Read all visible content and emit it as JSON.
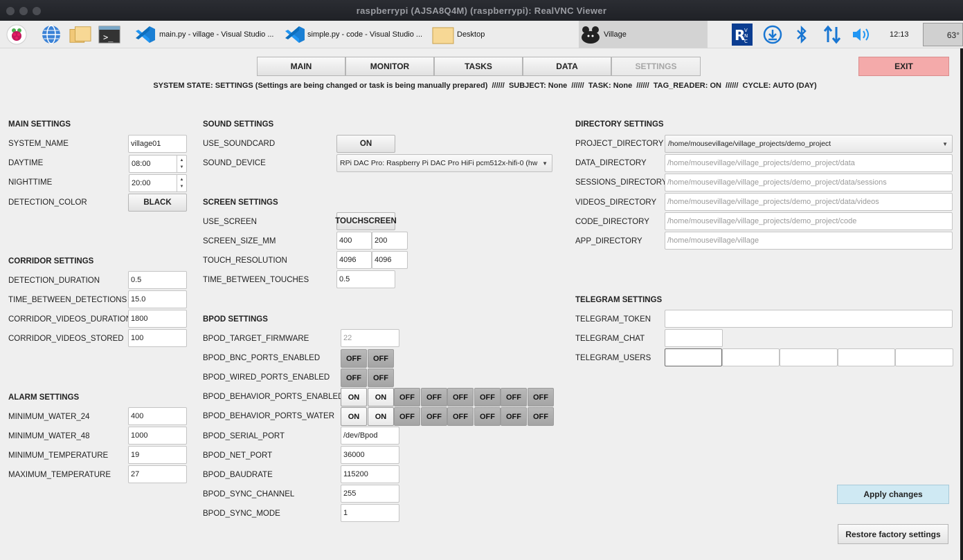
{
  "window": {
    "title": "raspberrypi (AJSA8Q4M) (raspberrypi): RealVNC Viewer"
  },
  "taskbar": {
    "apps": [
      {
        "label": "main.py - village - Visual Studio ..."
      },
      {
        "label": "simple.py - code - Visual Studio ..."
      },
      {
        "label": "Desktop"
      },
      {
        "label": "Village"
      }
    ],
    "clock": "12:13",
    "temperature": "63°"
  },
  "nav": {
    "tabs": [
      {
        "label": "MAIN"
      },
      {
        "label": "MONITOR"
      },
      {
        "label": "TASKS"
      },
      {
        "label": "DATA"
      },
      {
        "label": "SETTINGS"
      }
    ],
    "exit_label": "EXIT"
  },
  "status_line": "SYSTEM STATE: SETTINGS (Settings are being changed or task is being manually prepared)  //////  SUBJECT: None  //////  TASK: None  //////  TAG_READER: ON  //////  CYCLE: AUTO (DAY)",
  "main_settings": {
    "title": "MAIN SETTINGS",
    "rows": [
      {
        "label": "SYSTEM_NAME",
        "value": "village01"
      },
      {
        "label": "DAYTIME",
        "value": "08:00"
      },
      {
        "label": "NIGHTTIME",
        "value": "20:00"
      },
      {
        "label": "DETECTION_COLOR",
        "value": "BLACK"
      }
    ]
  },
  "corridor_settings": {
    "title": "CORRIDOR SETTINGS",
    "rows": [
      {
        "label": "DETECTION_DURATION",
        "value": "0.5"
      },
      {
        "label": "TIME_BETWEEN_DETECTIONS",
        "value": "15.0"
      },
      {
        "label": "CORRIDOR_VIDEOS_DURATION",
        "value": "1800"
      },
      {
        "label": "CORRIDOR_VIDEOS_STORED",
        "value": "100"
      }
    ]
  },
  "alarm_settings": {
    "title": "ALARM SETTINGS",
    "rows": [
      {
        "label": "MINIMUM_WATER_24",
        "value": "400"
      },
      {
        "label": "MINIMUM_WATER_48",
        "value": "1000"
      },
      {
        "label": "MINIMUM_TEMPERATURE",
        "value": "19"
      },
      {
        "label": "MAXIMUM_TEMPERATURE",
        "value": "27"
      }
    ]
  },
  "sound_settings": {
    "title": "SOUND SETTINGS",
    "use_soundcard_label": "USE_SOUNDCARD",
    "use_soundcard_value": "ON",
    "sound_device_label": "SOUND_DEVICE",
    "sound_device_value": "RPi DAC Pro: Raspberry Pi DAC Pro HiFi pcm512x-hifi-0 (hw"
  },
  "screen_settings": {
    "title": "SCREEN SETTINGS",
    "use_screen_label": "USE_SCREEN",
    "use_screen_value": "TOUCHSCREEN",
    "screen_size_label": "SCREEN_SIZE_MM",
    "screen_size_values": [
      "400",
      "200"
    ],
    "touch_resolution_label": "TOUCH_RESOLUTION",
    "touch_resolution_values": [
      "4096",
      "4096"
    ],
    "time_between_touches_label": "TIME_BETWEEN_TOUCHES",
    "time_between_touches_value": "0.5"
  },
  "bpod_settings": {
    "title": "BPOD SETTINGS",
    "target_firmware_label": "BPOD_TARGET_FIRMWARE",
    "target_firmware_value": "22",
    "bnc_label": "BPOD_BNC_PORTS_ENABLED",
    "bnc_values": [
      "OFF",
      "OFF"
    ],
    "wired_label": "BPOD_WIRED_PORTS_ENABLED",
    "wired_values": [
      "OFF",
      "OFF"
    ],
    "behavior_enabled_label": "BPOD_BEHAVIOR_PORTS_ENABLED",
    "behavior_enabled_values": [
      "ON",
      "ON",
      "OFF",
      "OFF",
      "OFF",
      "OFF",
      "OFF",
      "OFF"
    ],
    "behavior_water_label": "BPOD_BEHAVIOR_PORTS_WATER",
    "behavior_water_values": [
      "ON",
      "ON",
      "OFF",
      "OFF",
      "OFF",
      "OFF",
      "OFF",
      "OFF"
    ],
    "serial_port_label": "BPOD_SERIAL_PORT",
    "serial_port_value": "/dev/Bpod",
    "net_port_label": "BPOD_NET_PORT",
    "net_port_value": "36000",
    "baudrate_label": "BPOD_BAUDRATE",
    "baudrate_value": "115200",
    "sync_channel_label": "BPOD_SYNC_CHANNEL",
    "sync_channel_value": "255",
    "sync_mode_label": "BPOD_SYNC_MODE",
    "sync_mode_value": "1"
  },
  "directory_settings": {
    "title": "DIRECTORY SETTINGS",
    "project_label": "PROJECT_DIRECTORY",
    "project_value": "/home/mousevillage/village_projects/demo_project",
    "rows": [
      {
        "label": "DATA_DIRECTORY",
        "value": "/home/mousevillage/village_projects/demo_project/data"
      },
      {
        "label": "SESSIONS_DIRECTORY",
        "value": "/home/mousevillage/village_projects/demo_project/data/sessions"
      },
      {
        "label": "VIDEOS_DIRECTORY",
        "value": "/home/mousevillage/village_projects/demo_project/data/videos"
      },
      {
        "label": "CODE_DIRECTORY",
        "value": "/home/mousevillage/village_projects/demo_project/code"
      },
      {
        "label": "APP_DIRECTORY",
        "value": "/home/mousevillage/village"
      }
    ]
  },
  "telegram_settings": {
    "title": "TELEGRAM SETTINGS",
    "token_label": "TELEGRAM_TOKEN",
    "token_value": "",
    "chat_label": "TELEGRAM_CHAT",
    "chat_value": "",
    "users_label": "TELEGRAM_USERS",
    "users_values": [
      "",
      "",
      "",
      "",
      ""
    ]
  },
  "actions": {
    "apply_label": "Apply changes",
    "restore_label": "Restore factory settings"
  }
}
